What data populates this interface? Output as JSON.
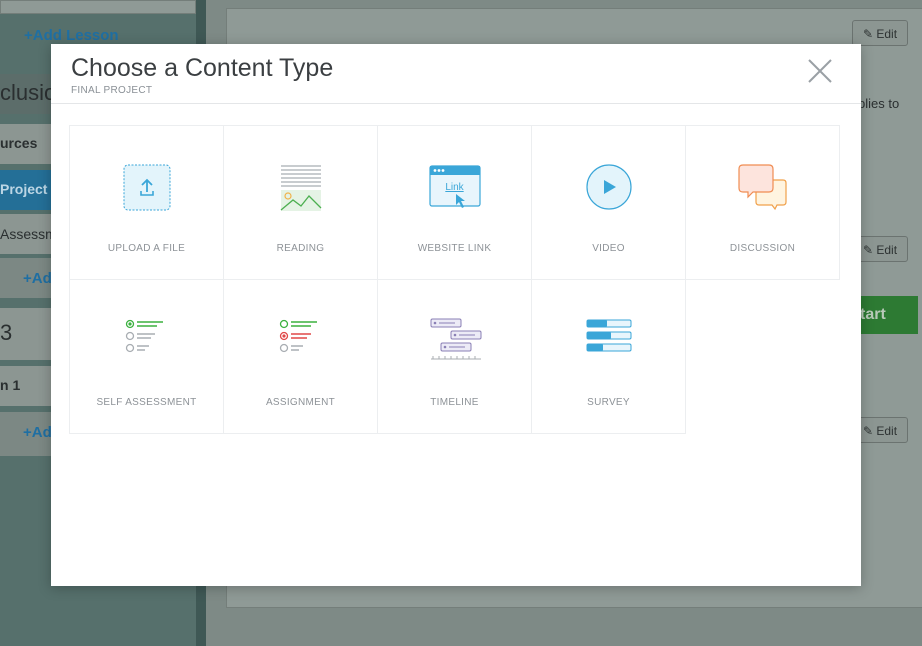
{
  "background": {
    "add_lesson_top": "+Add Lesson",
    "conclusion_fragment": "clusion",
    "resources_fragment": "urces",
    "project_fragment": "Project",
    "assessment_fragment": "Assessm",
    "add_fragment_1": "+Ad",
    "section_number": "3",
    "lesson_fragment": "n 1",
    "add_fragment_2": "+Ad",
    "edit_label": "Edit",
    "description_fragment": "plies to",
    "start_fragment": "tart"
  },
  "modal": {
    "title": "Choose a Content Type",
    "subtitle": "FINAL PROJECT",
    "close_icon": "close-icon",
    "content_types": [
      {
        "label": "UPLOAD A FILE",
        "icon": "upload-icon"
      },
      {
        "label": "READING",
        "icon": "reading-icon"
      },
      {
        "label": "WEBSITE LINK",
        "icon": "website-link-icon",
        "icon_text": "Link"
      },
      {
        "label": "VIDEO",
        "icon": "video-play-icon"
      },
      {
        "label": "DISCUSSION",
        "icon": "discussion-icon"
      },
      {
        "label": "SELF ASSESSMENT",
        "icon": "self-assessment-icon"
      },
      {
        "label": "ASSIGNMENT",
        "icon": "assignment-icon"
      },
      {
        "label": "TIMELINE",
        "icon": "timeline-icon"
      },
      {
        "label": "SURVEY",
        "icon": "survey-icon"
      }
    ]
  },
  "colors": {
    "accent_blue": "#3aa6d8",
    "green": "#3bb13f",
    "red": "#e04848",
    "orange": "#f0a04a",
    "purple": "#8a7fb5"
  }
}
